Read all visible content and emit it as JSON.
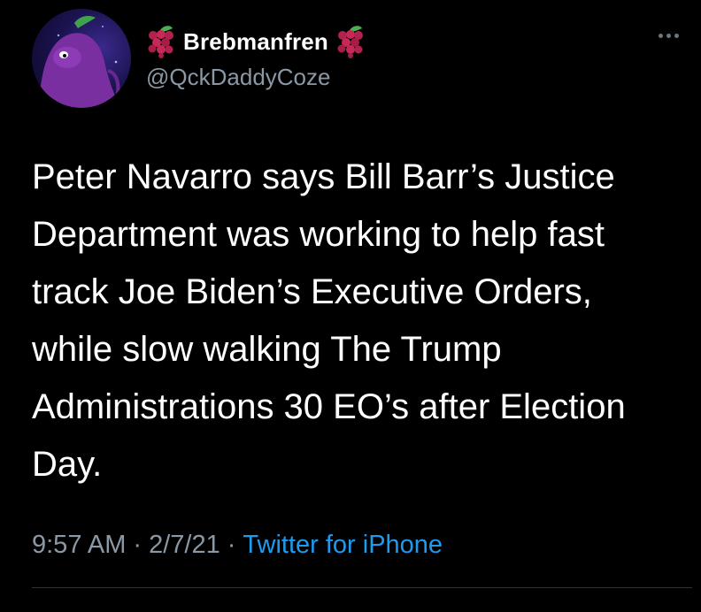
{
  "user": {
    "display_name": "Brebmanfren",
    "handle": "@QckDaddyCoze",
    "badge_icon": "grapes-icon"
  },
  "tweet": {
    "text": "Peter Navarro says Bill Barr’s Justice\nDepartment was working to help fast\ntrack Joe Biden’s Executive Orders,\nwhile slow walking The Trump\nAdministrations 30 EO’s after Election\nDay."
  },
  "meta": {
    "time": "9:57 AM",
    "date": "2/7/21",
    "separator": "·",
    "source": "Twitter for iPhone"
  },
  "colors": {
    "background": "#000000",
    "text": "#ffffff",
    "secondary": "#8b98a5",
    "link": "#1d9bf0",
    "avatar_accent": "#7a2fa0"
  }
}
